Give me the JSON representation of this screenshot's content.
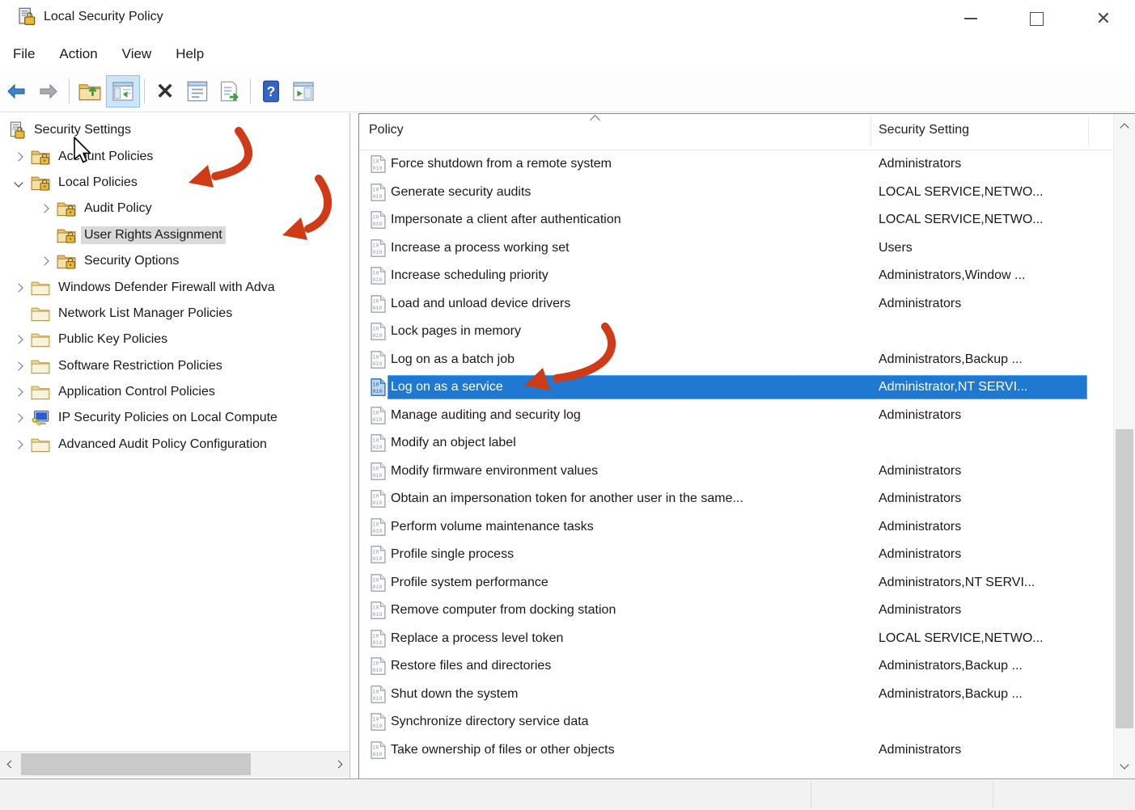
{
  "window": {
    "title": "Local Security Policy",
    "controls": {
      "minimize": "minimize",
      "maximize": "maximize",
      "close": "close"
    }
  },
  "menu": {
    "items": [
      "File",
      "Action",
      "View",
      "Help"
    ]
  },
  "toolbar": {
    "icons": [
      "back",
      "forward",
      "up-one-level",
      "show-console-tree",
      "delete",
      "properties",
      "export-list",
      "help",
      "new-window"
    ]
  },
  "tree": {
    "items": [
      {
        "label": "Security Settings",
        "icon": "root",
        "level": 0,
        "expander": "none",
        "selected": false
      },
      {
        "label": "Account Policies",
        "icon": "lock-folder",
        "level": 1,
        "expander": "collapsed",
        "selected": false
      },
      {
        "label": "Local Policies",
        "icon": "lock-folder",
        "level": 1,
        "expander": "expanded",
        "selected": false
      },
      {
        "label": "Audit Policy",
        "icon": "lock-folder",
        "level": 2,
        "expander": "collapsed",
        "selected": false
      },
      {
        "label": "User Rights Assignment",
        "icon": "lock-folder",
        "level": 2,
        "expander": "none",
        "selected": true
      },
      {
        "label": "Security Options",
        "icon": "lock-folder",
        "level": 2,
        "expander": "collapsed",
        "selected": false
      },
      {
        "label": "Windows Defender Firewall with Adva",
        "icon": "folder",
        "level": 1,
        "expander": "collapsed",
        "selected": false
      },
      {
        "label": "Network List Manager Policies",
        "icon": "folder",
        "level": 1,
        "expander": "none",
        "selected": false
      },
      {
        "label": "Public Key Policies",
        "icon": "folder",
        "level": 1,
        "expander": "collapsed",
        "selected": false
      },
      {
        "label": "Software Restriction Policies",
        "icon": "folder",
        "level": 1,
        "expander": "collapsed",
        "selected": false
      },
      {
        "label": "Application Control Policies",
        "icon": "folder",
        "level": 1,
        "expander": "collapsed",
        "selected": false
      },
      {
        "label": "IP Security Policies on Local Compute",
        "icon": "computer",
        "level": 1,
        "expander": "collapsed",
        "selected": false
      },
      {
        "label": "Advanced Audit Policy Configuration",
        "icon": "folder",
        "level": 1,
        "expander": "collapsed",
        "selected": false
      }
    ]
  },
  "list": {
    "columns": [
      "Policy",
      "Security Setting"
    ],
    "rows": [
      {
        "policy": "Force shutdown from a remote system",
        "setting": "Administrators",
        "selected": false
      },
      {
        "policy": "Generate security audits",
        "setting": "LOCAL SERVICE,NETWO...",
        "selected": false
      },
      {
        "policy": "Impersonate a client after authentication",
        "setting": "LOCAL SERVICE,NETWO...",
        "selected": false
      },
      {
        "policy": "Increase a process working set",
        "setting": "Users",
        "selected": false
      },
      {
        "policy": "Increase scheduling priority",
        "setting": "Administrators,Window ...",
        "selected": false
      },
      {
        "policy": "Load and unload device drivers",
        "setting": "Administrators",
        "selected": false
      },
      {
        "policy": "Lock pages in memory",
        "setting": "",
        "selected": false
      },
      {
        "policy": "Log on as a batch job",
        "setting": "Administrators,Backup ...",
        "selected": false
      },
      {
        "policy": "Log on as a service",
        "setting": "Administrator,NT SERVI...",
        "selected": true
      },
      {
        "policy": "Manage auditing and security log",
        "setting": "Administrators",
        "selected": false
      },
      {
        "policy": "Modify an object label",
        "setting": "",
        "selected": false
      },
      {
        "policy": "Modify firmware environment values",
        "setting": "Administrators",
        "selected": false
      },
      {
        "policy": "Obtain an impersonation token for another user in the same...",
        "setting": "Administrators",
        "selected": false
      },
      {
        "policy": "Perform volume maintenance tasks",
        "setting": "Administrators",
        "selected": false
      },
      {
        "policy": "Profile single process",
        "setting": "Administrators",
        "selected": false
      },
      {
        "policy": "Profile system performance",
        "setting": "Administrators,NT SERVI...",
        "selected": false
      },
      {
        "policy": "Remove computer from docking station",
        "setting": "Administrators",
        "selected": false
      },
      {
        "policy": "Replace a process level token",
        "setting": "LOCAL SERVICE,NETWO...",
        "selected": false
      },
      {
        "policy": "Restore files and directories",
        "setting": "Administrators,Backup ...",
        "selected": false
      },
      {
        "policy": "Shut down the system",
        "setting": "Administrators,Backup ...",
        "selected": false
      },
      {
        "policy": "Synchronize directory service data",
        "setting": "",
        "selected": false
      },
      {
        "policy": "Take ownership of files or other objects",
        "setting": "Administrators",
        "selected": false
      }
    ]
  },
  "colors": {
    "selection_blue": "#1f78d1",
    "tree_selection_gray": "#d9d9d9",
    "annotation_red": "#cf3a17"
  }
}
